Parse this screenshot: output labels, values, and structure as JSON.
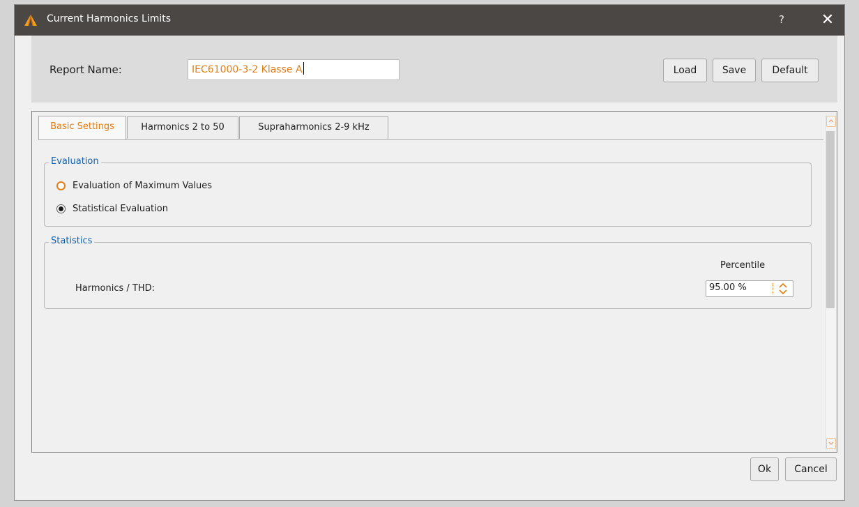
{
  "window": {
    "title": "Current Harmonics Limits",
    "help_glyph": "?",
    "close_glyph": "✕"
  },
  "report": {
    "label": "Report Name:",
    "value": "IEC61000-3-2 Klasse A"
  },
  "toolbar": {
    "load_label": "Load",
    "save_label": "Save",
    "default_label": "Default"
  },
  "tabs": [
    {
      "label": "Basic Settings",
      "active": true
    },
    {
      "label": "Harmonics 2 to 50",
      "active": false
    },
    {
      "label": "Supraharmonics 2-9 kHz",
      "active": false
    }
  ],
  "evaluation": {
    "title": "Evaluation",
    "options": [
      {
        "label": "Evaluation of Maximum Values",
        "selected": false
      },
      {
        "label": "Statistical Evaluation",
        "selected": true
      }
    ]
  },
  "statistics": {
    "title": "Statistics",
    "column_header": "Percentile",
    "row_label": "Harmonics / THD:",
    "percentile_value": "95.00 %"
  },
  "footer": {
    "ok_label": "Ok",
    "cancel_label": "Cancel"
  },
  "colors": {
    "accent": "#e27d14",
    "group_title": "#1560a8",
    "titlebar": "#4a4745"
  },
  "icons": {
    "app_logo": "orange-triangle-logo-icon",
    "spin": "up-down-chevron-icon"
  }
}
